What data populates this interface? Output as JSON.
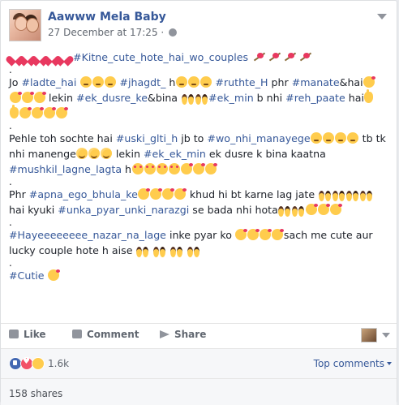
{
  "post": {
    "page_name": "Aawww Mela Baby",
    "timestamp": "27 December at 17:25",
    "separator": " · "
  },
  "content": {
    "line1_hash": "#Kitne_cute_hote_hai_wo_couples",
    "dot1": ".",
    "line2_a": "Jo ",
    "line2_h1": "#ladte_hai",
    "line2_h2": "#jhagdt_",
    "line2_b": " h",
    "line2_h3": "#ruthte_H",
    "line2_c": " phr ",
    "line2_h4": "#manate",
    "line2_d": "&hai",
    "line3_a": " lekin ",
    "line3_h1": "#ek_dusre_ke",
    "line3_b": "&bina ",
    "line3_h2": "#ek_min",
    "line3_c": " b nhi ",
    "line3_h3": "#reh_paate",
    "line3_d": " hai",
    "dot2": ".",
    "line4_a": "Pehle toh sochte hai ",
    "line4_h1": "#uski_glti_h",
    "line4_b": " jb to ",
    "line4_h2": "#wo_nhi_manayege",
    "line4_c": " tb tk",
    "line5_a": "nhi manenge",
    "line5_b": " lekin ",
    "line5_h1": "#ek_ek_min",
    "line5_c": " ek dusre k bina kaatna",
    "line6_h1": "#mushkil_lagne_lagta",
    "line6_a": " h",
    "dot3": ".",
    "line7_a": "Phr ",
    "line7_h1": "#apna_ego_bhula_ke",
    "line7_b": " khud hi bt karne lag jate ",
    "line8_a": "hai kyuki ",
    "line8_h1": "#unka_pyar_unki_narazgi",
    "line8_b": " se bada nhi hota",
    "dot4": ".",
    "line9_h1": "#Hayeeeeeeee_nazar_na_lage",
    "line9_a": " inke pyar ko ",
    "line9_b": "sach me cute aur",
    "line10_a": "lucky couple hote h aise ",
    "dot5": ".",
    "line11_h1": "#Cutie"
  },
  "actions": {
    "like": "Like",
    "comment": "Comment",
    "share": "Share"
  },
  "reactions": {
    "count": "1.6k",
    "top_comments": "Top comments"
  },
  "shares": {
    "label": "158 shares"
  },
  "colors": {
    "link": "#365899",
    "text": "#1d2129",
    "muted": "#616770",
    "heart": "#e8385f",
    "emoji_yellow": "#ffcc4d"
  }
}
